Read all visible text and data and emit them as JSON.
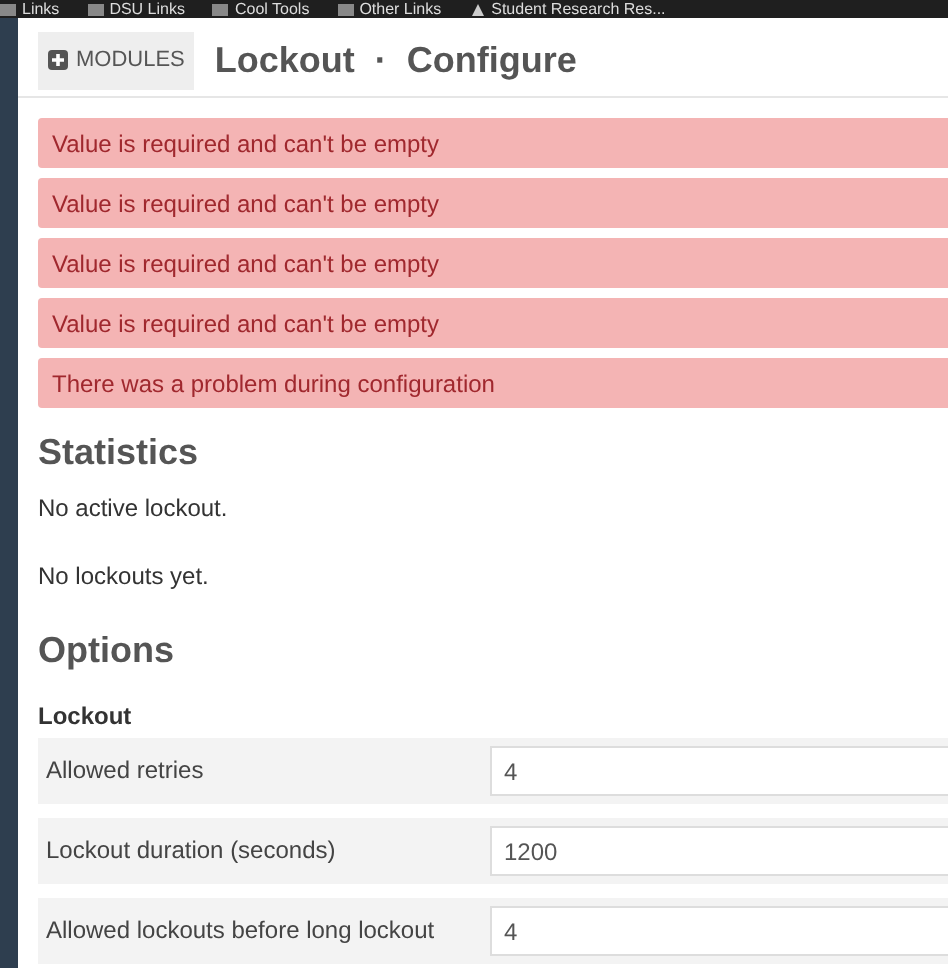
{
  "bookmarks_bar": {
    "items": [
      {
        "label": "Links",
        "kind": "folder"
      },
      {
        "label": "DSU Links",
        "kind": "folder"
      },
      {
        "label": "Cool Tools",
        "kind": "folder"
      },
      {
        "label": "Other Links",
        "kind": "folder"
      },
      {
        "label": "Student Research Res...",
        "kind": "site"
      }
    ]
  },
  "header": {
    "modules_button": "MODULES",
    "title": "Lockout",
    "separator": "·",
    "subtitle": "Configure"
  },
  "alerts": [
    {
      "text": "Value is required and can't be empty"
    },
    {
      "text": "Value is required and can't be empty"
    },
    {
      "text": "Value is required and can't be empty"
    },
    {
      "text": "Value is required and can't be empty"
    },
    {
      "text": "There was a problem during configuration"
    }
  ],
  "statistics": {
    "heading": "Statistics",
    "lines": [
      "No active lockout.",
      "No lockouts yet."
    ]
  },
  "options": {
    "heading": "Options",
    "group": "Lockout",
    "fields": [
      {
        "label": "Allowed retries",
        "value": "4"
      },
      {
        "label": "Lockout duration (seconds)",
        "value": "1200"
      },
      {
        "label": "Allowed lockouts before long lockout",
        "value": "4"
      }
    ]
  }
}
